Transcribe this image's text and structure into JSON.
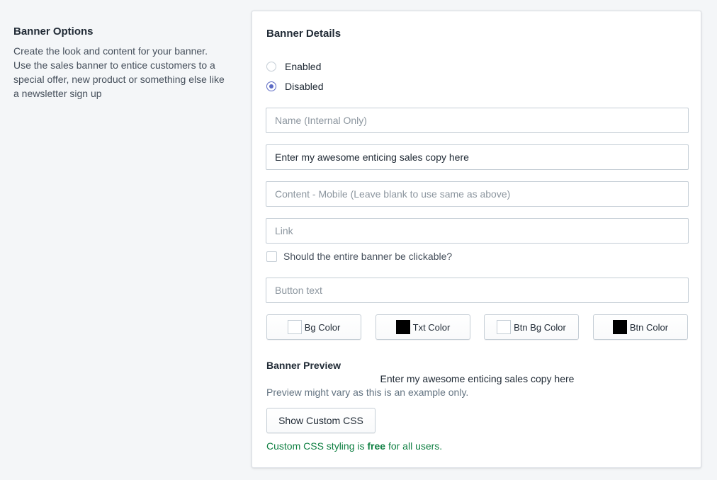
{
  "options": {
    "title": "Banner Options",
    "description": "Create the look and content for your banner. Use the sales banner to entice customers to a special offer, new product or something else like a newsletter sign up"
  },
  "details": {
    "title": "Banner Details",
    "status_options": [
      {
        "label": "Enabled",
        "selected": false
      },
      {
        "label": "Disabled",
        "selected": true
      }
    ],
    "fields": {
      "name": {
        "value": "",
        "placeholder": "Name (Internal Only)"
      },
      "content": {
        "value": "Enter my awesome enticing sales copy here",
        "placeholder": ""
      },
      "content_mobile": {
        "value": "",
        "placeholder": "Content - Mobile (Leave blank to use same as above)"
      },
      "link": {
        "value": "",
        "placeholder": "Link"
      },
      "button_text": {
        "value": "",
        "placeholder": "Button text"
      }
    },
    "clickable_checkbox": {
      "label": "Should the entire banner be clickable?",
      "checked": false
    },
    "color_buttons": [
      {
        "label": "Bg Color",
        "swatch": "#ffffff"
      },
      {
        "label": "Txt Color",
        "swatch": "#000000"
      },
      {
        "label": "Btn Bg Color",
        "swatch": "#ffffff"
      },
      {
        "label": "Btn Color",
        "swatch": "#000000"
      }
    ]
  },
  "preview": {
    "title": "Banner Preview",
    "banner_text": "Enter my awesome enticing sales copy here",
    "note": "Preview might vary as this is an example only.",
    "css_button": "Show Custom CSS",
    "free_note_prefix": "Custom CSS styling is",
    "free_note_bold": "free",
    "free_note_suffix": "for all users."
  },
  "colors": {
    "accent": "#5c6ac4",
    "success_text": "#108043",
    "page_bg": "#f4f6f8"
  }
}
